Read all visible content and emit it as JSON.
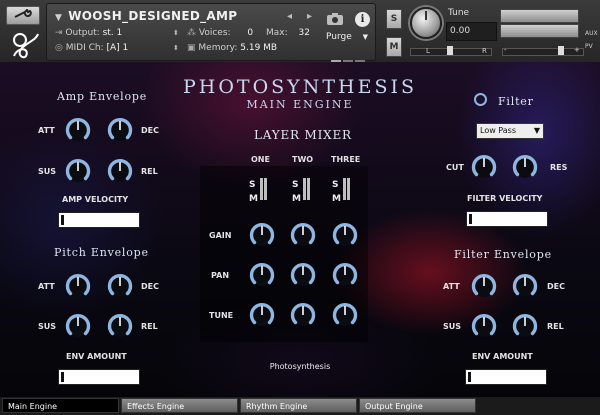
{
  "header": {
    "instrument_name": "WOOSH_DESIGNED_AMP",
    "output_label": "Output:",
    "output_value": "st. 1",
    "midi_label": "MIDI Ch:",
    "midi_value": "[A]  1",
    "voices_label": "Voices:",
    "voices_value": "0",
    "max_label": "Max:",
    "max_value": "32",
    "memory_label": "Memory:",
    "memory_value": "5.19 MB",
    "purge_label": "Purge",
    "solo_label": "S",
    "mute_label": "M",
    "tune_label": "Tune",
    "tune_value": "0.00",
    "pan_l": "L",
    "pan_r": "R",
    "aux_label": "AUX",
    "pv_label": "PV",
    "minus": "-",
    "plus": "+"
  },
  "main": {
    "title": "PHOTOSYNTHESIS",
    "subtitle": "MAIN ENGINE",
    "footer_text": "Photosynthesis"
  },
  "amp_envelope": {
    "heading": "Amp Envelope",
    "att": "ATT",
    "dec": "DEC",
    "sus": "SUS",
    "rel": "REL",
    "velocity_label": "AMP VELOCITY"
  },
  "pitch_envelope": {
    "heading": "Pitch Envelope",
    "att": "ATT",
    "dec": "DEC",
    "sus": "SUS",
    "rel": "REL",
    "amount_label": "ENV AMOUNT"
  },
  "layer_mixer": {
    "heading": "LAYER MIXER",
    "columns": [
      "ONE",
      "TWO",
      "THREE"
    ],
    "solo": "S",
    "mute": "M",
    "rows": [
      "GAIN",
      "PAN",
      "TUNE"
    ]
  },
  "filter": {
    "heading": "Filter",
    "type": "Low Pass",
    "cut": "CUT",
    "res": "RES",
    "velocity_label": "FILTER VELOCITY"
  },
  "filter_envelope": {
    "heading": "Filter Envelope",
    "att": "ATT",
    "dec": "DEC",
    "sus": "SUS",
    "rel": "REL",
    "amount_label": "ENV AMOUNT"
  },
  "tabs": [
    "Main Engine",
    "Effects Engine",
    "Rhythm Engine",
    "Output Engine"
  ],
  "colors": {
    "knob_arc": "#8fb6e0",
    "text": "#e4e4e4",
    "active_tab": "#000000"
  },
  "icons": [
    "wrench-icon",
    "camera-icon",
    "info-icon",
    "logo-icon",
    "chevron-down-icon"
  ]
}
